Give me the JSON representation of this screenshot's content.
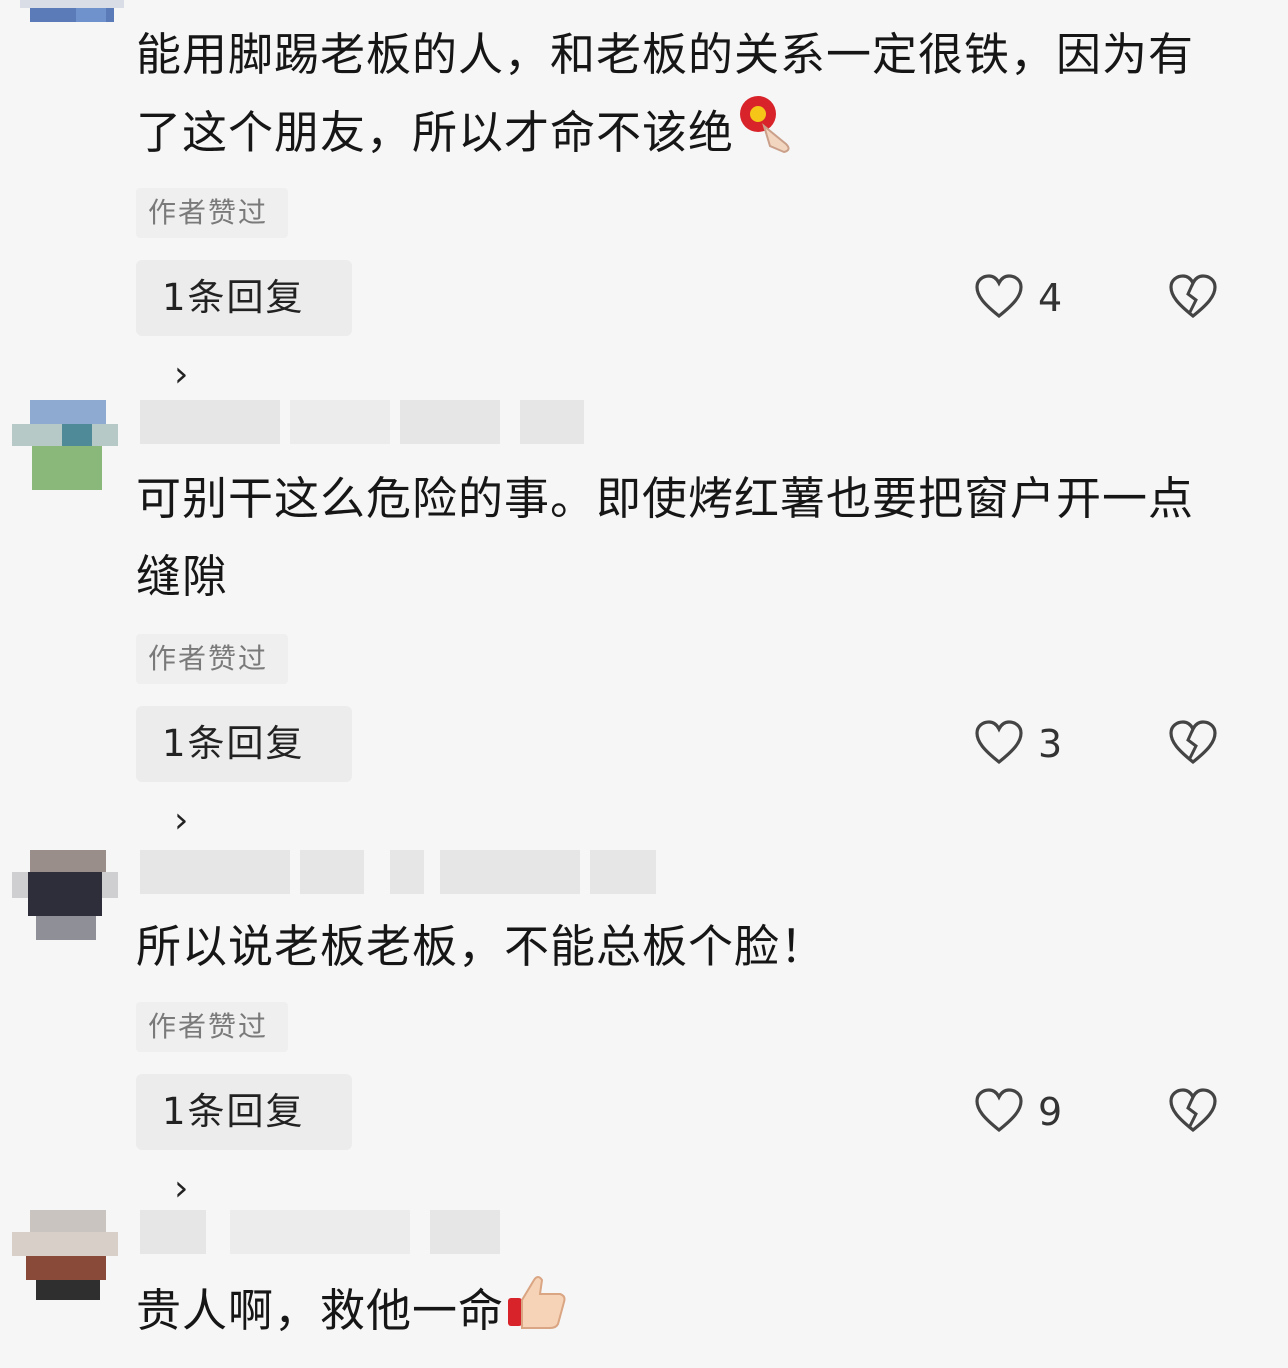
{
  "comments": [
    {
      "text": "能用脚踢老板的人，和老板的关系一定很铁，因为有了这个朋友，所以才命不该绝",
      "emoji": "flower-emoji",
      "tag": "作者赞过",
      "reply": "1条回复",
      "likes": "4"
    },
    {
      "text": "可别干这么危险的事。即使烤红薯也要把窗户开一点缝隙",
      "tag": "作者赞过",
      "reply": "1条回复",
      "likes": "3"
    },
    {
      "text": "所以说老板老板，不能总板个脸！",
      "tag": "作者赞过",
      "reply": "1条回复",
      "likes": "9"
    },
    {
      "text": "贵人啊，救他一命",
      "emoji": "thumbs-up-emoji"
    }
  ],
  "icons": {
    "like": "heart-outline-icon",
    "dislike": "broken-heart-outline-icon",
    "chevron": "chevron-right-icon"
  },
  "colors": {
    "background": "#f6f6f6",
    "text": "#161616",
    "tag_text": "#7a7a7a",
    "button_bg": "#ececec"
  }
}
